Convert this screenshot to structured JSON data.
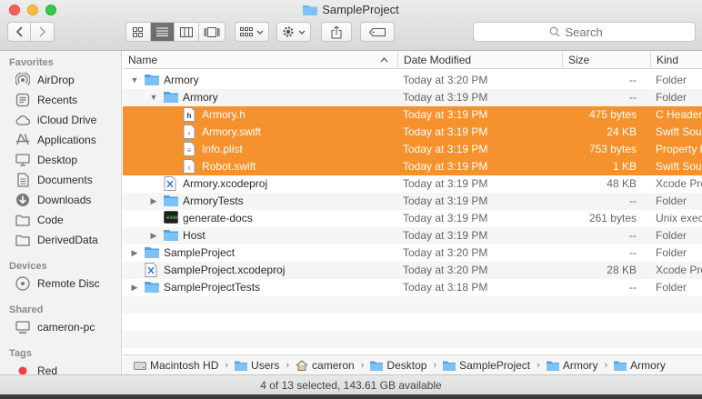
{
  "window": {
    "title": "SampleProject",
    "search_placeholder": "Search"
  },
  "sidebar": {
    "favorites_heading": "Favorites",
    "favorites": [
      {
        "label": "AirDrop",
        "icon": "airdrop-icon"
      },
      {
        "label": "Recents",
        "icon": "clock-icon"
      },
      {
        "label": "iCloud Drive",
        "icon": "cloud-icon"
      },
      {
        "label": "Applications",
        "icon": "applications-icon"
      },
      {
        "label": "Desktop",
        "icon": "desktop-icon"
      },
      {
        "label": "Documents",
        "icon": "document-icon"
      },
      {
        "label": "Downloads",
        "icon": "download-icon"
      },
      {
        "label": "Code",
        "icon": "folder-icon"
      },
      {
        "label": "DerivedData",
        "icon": "folder-icon"
      }
    ],
    "devices_heading": "Devices",
    "devices": [
      {
        "label": "Remote Disc",
        "icon": "disc-icon"
      }
    ],
    "shared_heading": "Shared",
    "shared": [
      {
        "label": "cameron-pc",
        "icon": "computer-icon"
      }
    ],
    "tags_heading": "Tags",
    "tags": [
      {
        "label": "Red",
        "color": "#fc3d39"
      }
    ]
  },
  "columns": {
    "name": "Name",
    "date": "Date Modified",
    "size": "Size",
    "kind": "Kind"
  },
  "rows": [
    {
      "name": "Armory",
      "date": "Today at 3:20 PM",
      "size": "--",
      "kind": "Folder",
      "type": "folder",
      "indent": 0,
      "disclosure": "open",
      "selected": false
    },
    {
      "name": "Armory",
      "date": "Today at 3:19 PM",
      "size": "--",
      "kind": "Folder",
      "type": "folder",
      "indent": 1,
      "disclosure": "open",
      "selected": false
    },
    {
      "name": "Armory.h",
      "date": "Today at 3:19 PM",
      "size": "475 bytes",
      "kind": "C Header",
      "type": "header",
      "indent": 2,
      "disclosure": "none",
      "selected": true
    },
    {
      "name": "Armory.swift",
      "date": "Today at 3:19 PM",
      "size": "24 KB",
      "kind": "Swift Source",
      "type": "swift",
      "indent": 2,
      "disclosure": "none",
      "selected": true
    },
    {
      "name": "Info.plist",
      "date": "Today at 3:19 PM",
      "size": "753 bytes",
      "kind": "Property List",
      "type": "plist",
      "indent": 2,
      "disclosure": "none",
      "selected": true
    },
    {
      "name": "Robot.swift",
      "date": "Today at 3:19 PM",
      "size": "1 KB",
      "kind": "Swift Source",
      "type": "swift",
      "indent": 2,
      "disclosure": "none",
      "selected": true
    },
    {
      "name": "Armory.xcodeproj",
      "date": "Today at 3:19 PM",
      "size": "48 KB",
      "kind": "Xcode Project",
      "type": "xcodeproj",
      "indent": 1,
      "disclosure": "none",
      "selected": false
    },
    {
      "name": "ArmoryTests",
      "date": "Today at 3:19 PM",
      "size": "--",
      "kind": "Folder",
      "type": "folder",
      "indent": 1,
      "disclosure": "closed",
      "selected": false
    },
    {
      "name": "generate-docs",
      "date": "Today at 3:19 PM",
      "size": "261 bytes",
      "kind": "Unix executable",
      "type": "exec",
      "indent": 1,
      "disclosure": "none",
      "selected": false
    },
    {
      "name": "Host",
      "date": "Today at 3:19 PM",
      "size": "--",
      "kind": "Folder",
      "type": "folder",
      "indent": 1,
      "disclosure": "closed",
      "selected": false
    },
    {
      "name": "SampleProject",
      "date": "Today at 3:20 PM",
      "size": "--",
      "kind": "Folder",
      "type": "folder",
      "indent": 0,
      "disclosure": "closed",
      "selected": false
    },
    {
      "name": "SampleProject.xcodeproj",
      "date": "Today at 3:20 PM",
      "size": "28 KB",
      "kind": "Xcode Project",
      "type": "xcodeproj",
      "indent": 0,
      "disclosure": "none",
      "selected": false
    },
    {
      "name": "SampleProjectTests",
      "date": "Today at 3:18 PM",
      "size": "--",
      "kind": "Folder",
      "type": "folder",
      "indent": 0,
      "disclosure": "closed",
      "selected": false
    }
  ],
  "pathbar": [
    {
      "label": "Macintosh HD",
      "icon": "hard-drive-icon"
    },
    {
      "label": "Users",
      "icon": "folder-icon"
    },
    {
      "label": "cameron",
      "icon": "home-icon"
    },
    {
      "label": "Desktop",
      "icon": "folder-icon"
    },
    {
      "label": "SampleProject",
      "icon": "folder-icon"
    },
    {
      "label": "Armory",
      "icon": "folder-icon"
    },
    {
      "label": "Armory",
      "icon": "folder-icon"
    }
  ],
  "status": "4 of 13 selected, 143.61 GB available",
  "colors": {
    "selection": "#f5922d",
    "folder": "#5fb0ec"
  }
}
